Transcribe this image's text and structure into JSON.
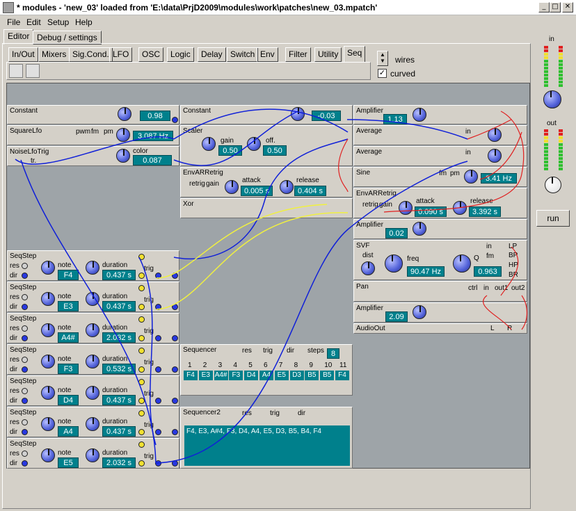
{
  "window": {
    "title": "* modules - 'new_03' loaded from 'E:\\data\\PrjD2009\\modules\\work\\patches\\new_03.mpatch'",
    "min_icon": "_",
    "max_icon": "□",
    "close_icon": "✕"
  },
  "menu": [
    "File",
    "Edit",
    "Setup",
    "Help"
  ],
  "main_tabs": [
    "Editor",
    "Debug / settings"
  ],
  "palette_tabs": [
    "In/Out",
    "Mixers",
    "Sig.Cond.",
    "LFO",
    "OSC",
    "Logic",
    "Delay",
    "Switch",
    "Env",
    "Filter",
    "Utility",
    "Seq"
  ],
  "options": {
    "wires": "wires",
    "curved": "curved"
  },
  "right": {
    "in": "in",
    "out": "out",
    "run": "run"
  },
  "modules": {
    "constant1": {
      "title": "Constant",
      "value": "0.98"
    },
    "constant2": {
      "title": "Constant",
      "value": "-0.03"
    },
    "squarelfo": {
      "title": "SquareLfo",
      "pwm": "pwm",
      "fm": "fm",
      "pm": "pm",
      "value": "3.087 Hz"
    },
    "noiselfo": {
      "title": "NoiseLfoTrig",
      "tr": "tr.",
      "color": "color",
      "value": "0.087"
    },
    "scaler": {
      "title": "Scaler",
      "gain": "gain",
      "off": "off.",
      "gain_val": "0.50",
      "off_val": "0.50"
    },
    "envar1": {
      "title": "EnvARRetrig",
      "retrig": "retrig",
      "gain": "gain",
      "attack": "attack",
      "release": "release",
      "attack_val": "0.005 s",
      "release_val": "0.404 s"
    },
    "xor": {
      "title": "Xor"
    },
    "amp1": {
      "title": "Amplifier",
      "value": "1.13"
    },
    "avg1": {
      "title": "Average",
      "in": "in"
    },
    "avg2": {
      "title": "Average",
      "in": "in"
    },
    "sine": {
      "title": "Sine",
      "fm": "fm",
      "pm": "pm",
      "value": "3.41 Hz"
    },
    "envar2": {
      "title": "EnvARRetrig",
      "retrig": "retrig",
      "gain": "gain",
      "attack": "attack",
      "release": "release",
      "attack_val": "0.090 s",
      "release_val": "3.392 s"
    },
    "amp2": {
      "title": "Amplifier",
      "value": "0.02"
    },
    "svf": {
      "title": "SVF",
      "dist": "dist",
      "freq": "freq",
      "q": "Q",
      "in": "in",
      "lp": "LP",
      "bp": "BP",
      "hp": "HP",
      "br": "BR",
      "fm": "fm",
      "freq_val": "90.47 Hz",
      "q_val": "0.963"
    },
    "pan": {
      "title": "Pan",
      "ctrl": "ctrl",
      "in": "in",
      "out1": "out1",
      "out2": "out2"
    },
    "amp3": {
      "title": "Amplifier",
      "value": "2.09"
    },
    "audioout": {
      "title": "AudioOut",
      "l": "L",
      "r": "R"
    },
    "sequencer": {
      "title": "Sequencer",
      "res": "res",
      "trig": "trig",
      "dir": "dir",
      "steps": "steps",
      "steps_val": "8",
      "nums": [
        "1",
        "2",
        "3",
        "4",
        "5",
        "6",
        "7",
        "8",
        "9",
        "10",
        "11"
      ],
      "notes": [
        "F4",
        "E3",
        "A4#",
        "F3",
        "D4",
        "A4",
        "E5",
        "D3",
        "B5",
        "B5",
        "F4"
      ]
    },
    "sequencer2": {
      "title": "Sequencer2",
      "res": "res",
      "trig": "trig",
      "dir": "dir",
      "text": "F4, E3, A#4, F3, D4, A4, E5, D3, B5, B4, F4"
    }
  },
  "seqsteps": [
    {
      "title": "SeqStep",
      "note": "F4",
      "duration": "0.437 s"
    },
    {
      "title": "SeqStep",
      "note": "E3",
      "duration": "0.437 s"
    },
    {
      "title": "SeqStep",
      "note": "A4#",
      "duration": "2.032 s"
    },
    {
      "title": "SeqStep",
      "note": "F3",
      "duration": "0.532 s"
    },
    {
      "title": "SeqStep",
      "note": "D4",
      "duration": "0.437 s"
    },
    {
      "title": "SeqStep",
      "note": "A4",
      "duration": "0.437 s"
    },
    {
      "title": "SeqStep",
      "note": "E5",
      "duration": "2.032 s"
    }
  ],
  "seqstep_labels": {
    "res": "res",
    "dir": "dir",
    "note": "note",
    "duration": "duration",
    "trig": "trig"
  },
  "colors": {
    "canvas": "#9ea4a8",
    "display": "#00808c",
    "wire_blue": "#1020d8",
    "wire_red": "#e02020",
    "wire_yellow": "#f0f040"
  }
}
